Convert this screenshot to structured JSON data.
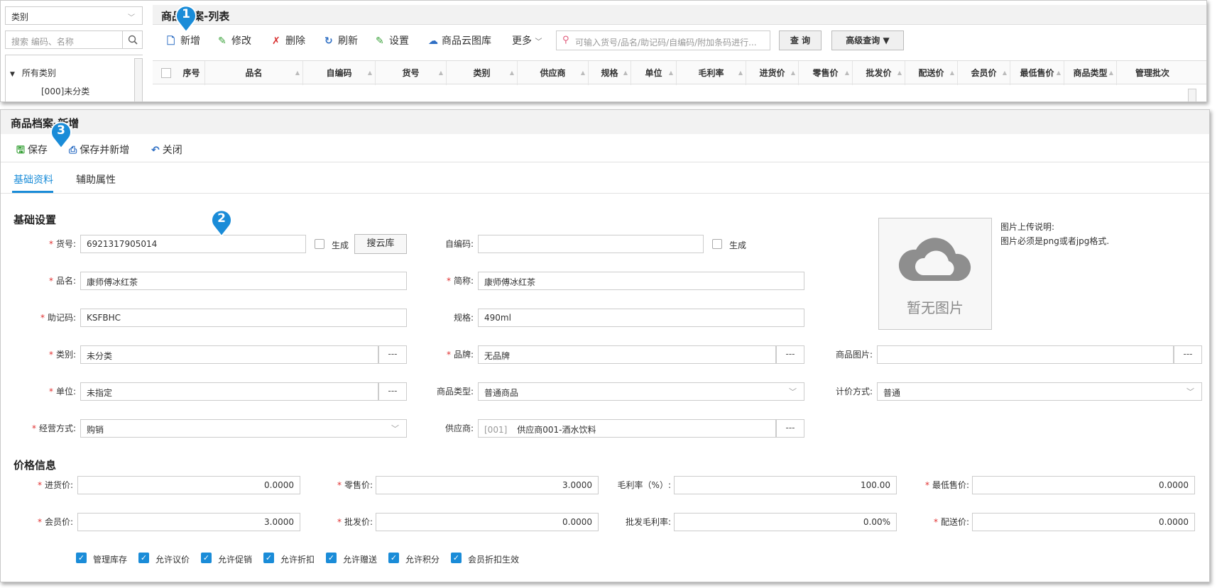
{
  "list_window": {
    "category_select": "类别",
    "category_search_placeholder": "搜索 编码、名称",
    "tree_root": "所有类别",
    "tree_leaf": "[000]未分类",
    "title": "商品档案-列表",
    "toolbar": {
      "add": "新增",
      "edit": "修改",
      "delete": "删除",
      "refresh": "刷新",
      "settings": "设置",
      "cloud": "商品云图库",
      "more": "更多"
    },
    "search_placeholder": "可输入货号/品名/助记码/自编码/附加条码进行...",
    "query_button": "查 询",
    "advanced_button": "高级查询",
    "columns": [
      "序号",
      "品名",
      "自编码",
      "货号",
      "类别",
      "供应商",
      "规格",
      "单位",
      "毛利率",
      "进货价",
      "零售价",
      "批发价",
      "配送价",
      "会员价",
      "最低售价",
      "商品类型",
      "管理批次"
    ]
  },
  "form_window": {
    "title": "商品档案-新增",
    "toolbar": {
      "save": "保存",
      "save_new": "保存并新增",
      "close": "关闭"
    },
    "tabs": [
      "基础资料",
      "辅助属性"
    ],
    "basic_section": "基础设置",
    "price_section": "价格信息",
    "fields": {
      "sku_label": "货号:",
      "sku_value": "6921317905014",
      "generate": "生成",
      "search_cloud": "搜云库",
      "selfcode_label": "自编码:",
      "selfcode_value": "",
      "name_label": "品名:",
      "name_value": "康师傅冰红茶",
      "short_label": "简称:",
      "short_value": "康师傅冰红茶",
      "mnemonic_label": "助记码:",
      "mnemonic_value": "KSFBHC",
      "spec_label": "规格:",
      "spec_value": "490ml",
      "category_label": "类别:",
      "category_value": "未分类",
      "brand_label": "品牌:",
      "brand_value": "无品牌",
      "image_label": "商品图片:",
      "image_value": "",
      "unit_label": "单位:",
      "unit_value": "未指定",
      "type_label": "商品类型:",
      "type_value": "普通商品",
      "pricing_label": "计价方式:",
      "pricing_value": "普通",
      "mode_label": "经营方式:",
      "mode_value": "购销",
      "supplier_label": "供应商:",
      "supplier_code": "[001]",
      "supplier_value": "供应商001-酒水饮料",
      "dots": "---"
    },
    "image": {
      "placeholder": "暂无图片",
      "note_title": "图片上传说明:",
      "note_text": "图片必须是png或者jpg格式."
    },
    "prices": {
      "purchase_label": "进货价:",
      "purchase_value": "0.0000",
      "retail_label": "零售价:",
      "retail_value": "3.0000",
      "margin_label": "毛利率（%）:",
      "margin_value": "100.00",
      "min_label": "最低售价:",
      "min_value": "0.0000",
      "member_label": "会员价:",
      "member_value": "3.0000",
      "wholesale_label": "批发价:",
      "wholesale_value": "0.0000",
      "wmargin_label": "批发毛利率:",
      "wmargin_value": "0.00%",
      "delivery_label": "配送价:",
      "delivery_value": "0.0000"
    },
    "options": [
      "管理库存",
      "允许议价",
      "允许促销",
      "允许折扣",
      "允许赠送",
      "允许积分",
      "会员折扣生效"
    ]
  },
  "markers": [
    "1",
    "2",
    "3"
  ],
  "colors": {
    "accent": "#1a8cd8",
    "required": "#e03030",
    "marker": "#1a8cd8"
  }
}
